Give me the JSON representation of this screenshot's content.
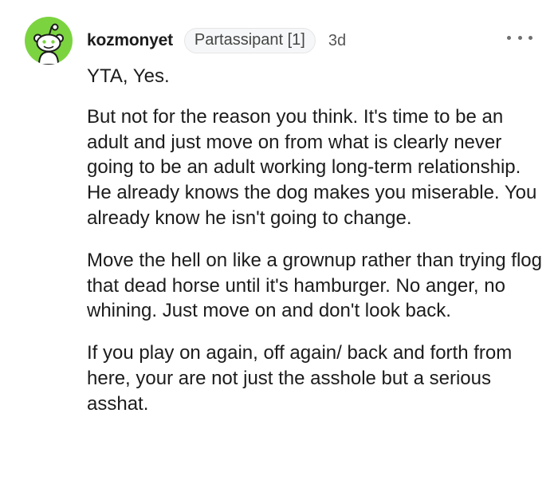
{
  "comment": {
    "author": "kozmonyet",
    "flair": "Partassipant [1]",
    "age": "3d",
    "avatar_icon": "reddit-snoo-icon",
    "avatar_color": "#7bd43f",
    "more_icon": "more-options-icon",
    "paragraphs": [
      "YTA, Yes.",
      "But not for the reason you think. It's time to be an adult and just move on from what is clearly never going to be an adult working long-term relationship. He already knows the dog makes you miserable. You already know he isn't going to change.",
      "Move the hell on like a grownup rather than trying flog that dead horse until it's hamburger. No anger, no whining. Just move on and don't look back.",
      "If you play on again, off again/ back and forth from here, your are not just the asshole but a serious asshat."
    ]
  }
}
